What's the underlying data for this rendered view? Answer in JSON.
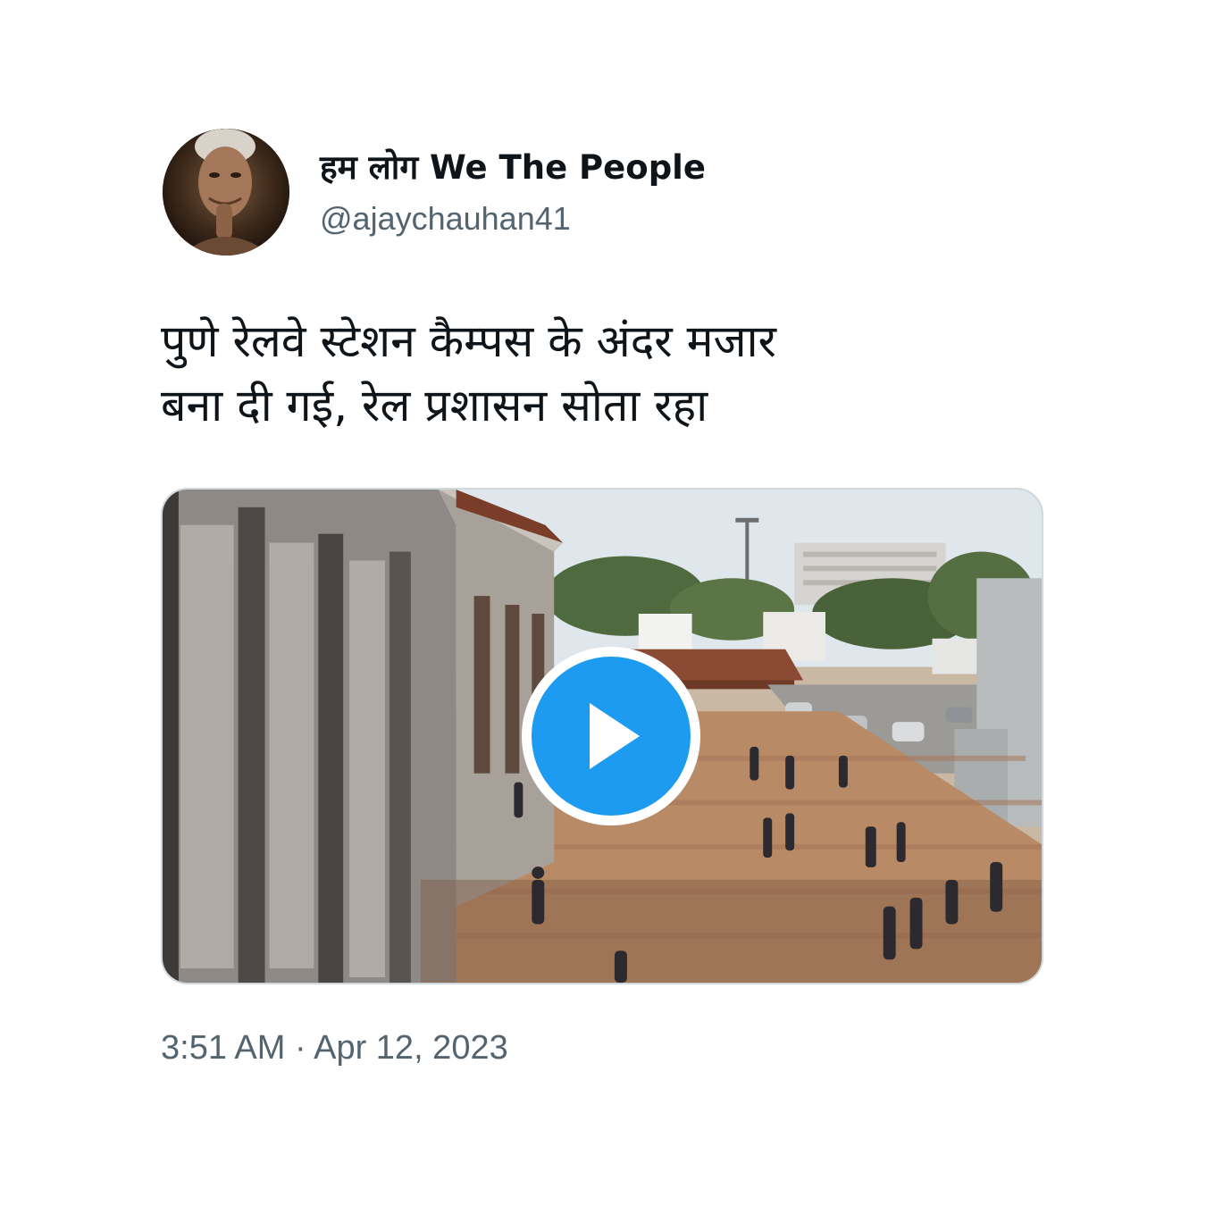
{
  "tweet": {
    "display_name": "हम लोग We The People",
    "handle": "@ajaychauhan41",
    "text_lines": [
      "पुणे रेलवे स्टेशन कैम्पस के अंदर मजार",
      "बना दी गई, रेल प्रशासन सोता रहा"
    ],
    "time": "3:51 AM",
    "separator": "·",
    "date": "Apr 12, 2023",
    "avatar_icon": "portrait-avatar",
    "media": {
      "type": "video",
      "play_icon": "play-icon",
      "play_color": "#1d9bf0"
    }
  }
}
